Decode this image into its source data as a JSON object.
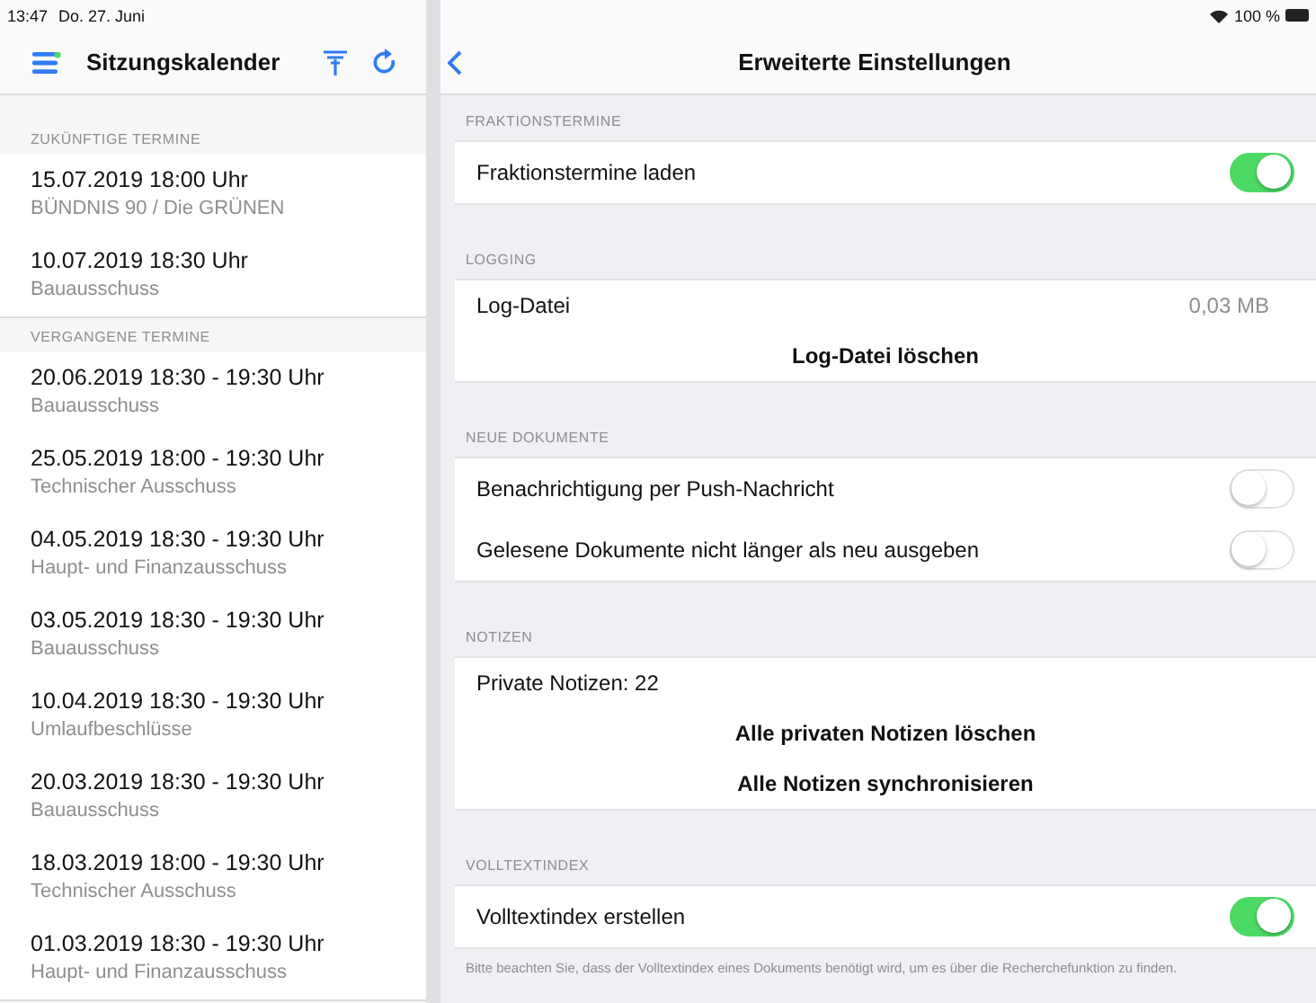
{
  "status_bar": {
    "time": "13:47",
    "date": "Do. 27. Juni",
    "battery": "100 %"
  },
  "sidebar": {
    "title": "Sitzungskalender",
    "sections": [
      {
        "header": "ZUKÜNFTIGE TERMINE",
        "items": [
          {
            "title": "15.07.2019 18:00 Uhr",
            "subtitle": "BÜNDNIS 90 / Die GRÜNEN"
          },
          {
            "title": "10.07.2019 18:30 Uhr",
            "subtitle": "Bauausschuss"
          }
        ]
      },
      {
        "header": "VERGANGENE TERMINE",
        "items": [
          {
            "title": "20.06.2019 18:30 -  19:30 Uhr",
            "subtitle": "Bauausschuss"
          },
          {
            "title": "25.05.2019 18:00 -  19:30 Uhr",
            "subtitle": "Technischer Ausschuss"
          },
          {
            "title": "04.05.2019 18:30 -  19:30 Uhr",
            "subtitle": "Haupt- und Finanzausschuss"
          },
          {
            "title": "03.05.2019 18:30 -  19:30 Uhr",
            "subtitle": "Bauausschuss"
          },
          {
            "title": "10.04.2019 18:30 -  19:30 Uhr",
            "subtitle": "Umlaufbeschlüsse"
          },
          {
            "title": "20.03.2019 18:30 -  19:30 Uhr",
            "subtitle": "Bauausschuss"
          },
          {
            "title": "18.03.2019 18:00 -  19:30 Uhr",
            "subtitle": "Technischer Ausschuss"
          },
          {
            "title": "01.03.2019 18:30 -  19:30 Uhr",
            "subtitle": "Haupt- und Finanzausschuss"
          }
        ]
      }
    ]
  },
  "detail": {
    "title": "Erweiterte Einstellungen",
    "sections": [
      {
        "header": "FRAKTIONSTERMINE",
        "rows": [
          {
            "kind": "toggle",
            "label": "Fraktionstermine laden",
            "on": true
          }
        ]
      },
      {
        "header": "LOGGING",
        "rows": [
          {
            "kind": "value",
            "label": "Log-Datei",
            "value": "0,03 MB"
          },
          {
            "kind": "action",
            "label": "Log-Datei löschen"
          }
        ]
      },
      {
        "header": "NEUE DOKUMENTE",
        "rows": [
          {
            "kind": "toggle",
            "label": "Benachrichtigung per Push-Nachricht",
            "on": false
          },
          {
            "kind": "toggle",
            "label": "Gelesene Dokumente nicht länger als neu ausgeben",
            "on": false
          }
        ]
      },
      {
        "header": "NOTIZEN",
        "rows": [
          {
            "kind": "text",
            "label": "Private Notizen: 22"
          },
          {
            "kind": "action",
            "label": "Alle privaten Notizen löschen"
          },
          {
            "kind": "action",
            "label": "Alle Notizen synchronisieren"
          }
        ]
      },
      {
        "header": "VOLLTEXTINDEX",
        "rows": [
          {
            "kind": "toggle",
            "label": "Volltextindex erstellen",
            "on": true
          }
        ],
        "footer": "Bitte beachten Sie, dass der Volltextindex eines Dokuments benötigt wird, um es über die Recherchefunktion zu finden."
      }
    ]
  }
}
